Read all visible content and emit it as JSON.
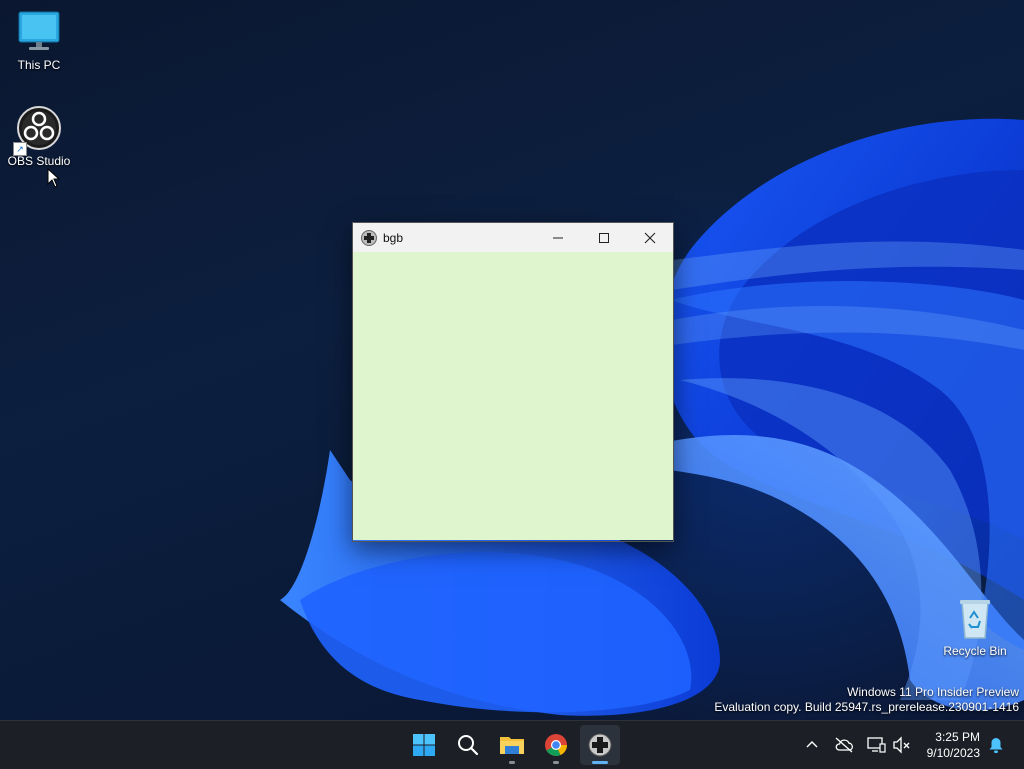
{
  "desktop": {
    "icons": [
      {
        "label": "This PC",
        "icon": "monitor-icon"
      },
      {
        "label": "OBS Studio",
        "icon": "obs-icon"
      },
      {
        "label": "Recycle Bin",
        "icon": "recycle-bin-icon"
      }
    ],
    "watermark": {
      "line1": "Windows 11 Pro Insider Preview",
      "line2": "Evaluation copy. Build 25947.rs_prerelease.230901-1416"
    }
  },
  "window": {
    "title": "bgb",
    "icon": "gamepad-icon",
    "client_color": "#dff5cd"
  },
  "taskbar": {
    "apps": [
      {
        "name": "Start",
        "icon": "windows-start-icon"
      },
      {
        "name": "Search",
        "icon": "search-icon"
      },
      {
        "name": "File Explorer",
        "icon": "folder-icon"
      },
      {
        "name": "Google Chrome",
        "icon": "chrome-icon"
      },
      {
        "name": "bgb",
        "icon": "gamepad-icon",
        "active": true
      }
    ],
    "tray": {
      "icons": [
        "chevron-up-icon",
        "cloud-off-icon",
        "network-icon",
        "speaker-muted-icon",
        "notification-bell-icon"
      ],
      "time": "3:25 PM",
      "date": "9/10/2023"
    }
  },
  "colors": {
    "accent": "#5fb2f2",
    "taskbar": "#1c2026"
  }
}
